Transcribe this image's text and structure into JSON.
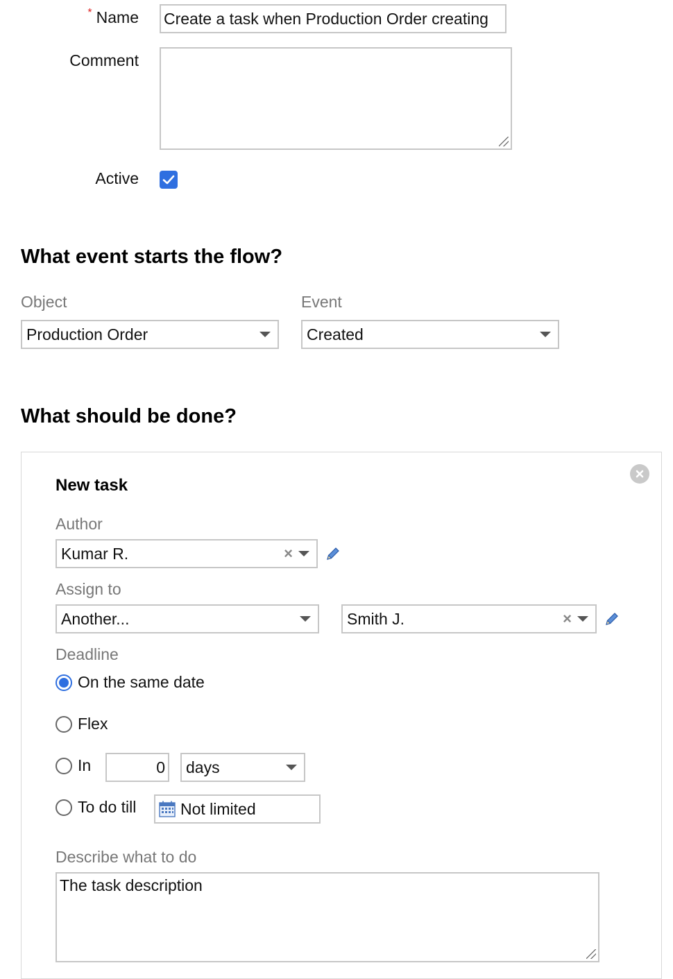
{
  "form": {
    "name_label": "Name",
    "name_value": "Create a task when Production Order creating",
    "comment_label": "Comment",
    "comment_value": "",
    "active_label": "Active",
    "active_checked": true
  },
  "trigger": {
    "heading": "What event starts the flow?",
    "object_label": "Object",
    "object_value": "Production Order",
    "event_label": "Event",
    "event_value": "Created"
  },
  "action": {
    "heading": "What should be done?",
    "task_title": "New task",
    "author_label": "Author",
    "author_value": "Kumar R.",
    "assign_label": "Assign to",
    "assign_mode_value": "Another...",
    "assignee_value": "Smith J.",
    "deadline_label": "Deadline",
    "deadline_options": {
      "same_date": "On the same date",
      "flex": "Flex",
      "in": "In",
      "to_do_till": "To do till"
    },
    "deadline_selected": "same_date",
    "in_amount": "0",
    "in_unit": "days",
    "till_value": "Not limited",
    "describe_label": "Describe what to do",
    "describe_value": "The task description"
  },
  "colors": {
    "accent": "#2f6fe0",
    "required": "#dd2222",
    "muted_label": "#777777",
    "border": "#c6c6c6"
  },
  "icons": [
    "check-icon",
    "chevron-down-icon",
    "clear-x-icon",
    "pencil-icon",
    "calendar-icon",
    "close-circle-icon",
    "resize-handle-icon"
  ]
}
